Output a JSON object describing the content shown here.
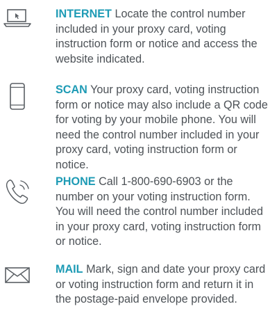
{
  "accent_color": "#1e9bb5",
  "text_color": "#4d5257",
  "icon_color": "#5a5f64",
  "items": [
    {
      "icon": "laptop-icon",
      "keyword": "INTERNET",
      "body": "Locate the control number included in your proxy card, voting instruction form or notice and access the website indicated."
    },
    {
      "icon": "smartphone-icon",
      "keyword": "SCAN",
      "body": "Your proxy card, voting instruction form or notice may also include a QR code for voting by your mobile phone. You will need the control number included in your proxy card, voting instruction form or notice."
    },
    {
      "icon": "phone-icon",
      "keyword": "PHONE",
      "body": "Call 1-800-690-6903 or the number on your voting instruction form. You will need the control number included in your proxy card, voting instruction form or notice."
    },
    {
      "icon": "envelope-icon",
      "keyword": "MAIL",
      "body": "Mark, sign and date your proxy card or voting instruction form and return it in the postage-paid envelope provided."
    }
  ]
}
